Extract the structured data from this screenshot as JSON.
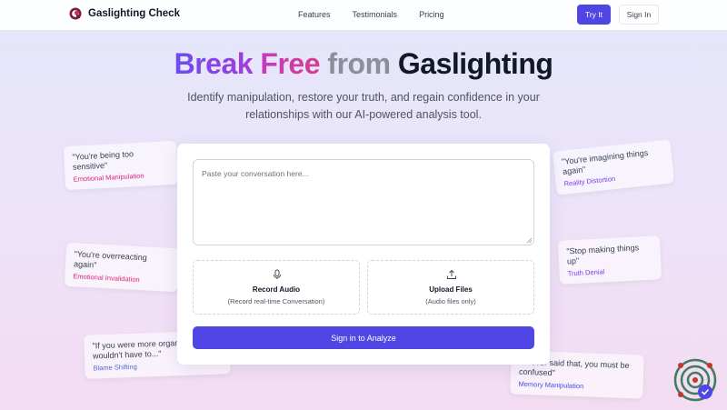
{
  "nav": {
    "brand": "Gaslighting Check",
    "links": [
      "Features",
      "Testimonials",
      "Pricing"
    ],
    "try_label": "Try It",
    "signin_label": "Sign In"
  },
  "hero": {
    "headline_parts": [
      "Break",
      "Free",
      "from",
      "Gaslighting"
    ],
    "subtitle": "Identify manipulation, restore your truth, and regain confidence in your relationships with our AI-powered analysis tool."
  },
  "quotes": [
    {
      "text": "\"You're being too sensitive\"",
      "tag": "Emotional Manipulation",
      "tag_color": "#db2777"
    },
    {
      "text": "\"You're overreacting again\"",
      "tag": "Emotional Invalidation",
      "tag_color": "#db2777"
    },
    {
      "text": "\"If you were more organized, I wouldn't have to...\"",
      "tag": "Blame Shifting",
      "tag_color": "#4f6bd8"
    },
    {
      "text": "\"You're imagining things again\"",
      "tag": "Reality Distortion",
      "tag_color": "#7c3aed"
    },
    {
      "text": "\"Stop making things up\"",
      "tag": "Truth Denial",
      "tag_color": "#7c3aed"
    },
    {
      "text": "\"I never said that, you must be confused\"",
      "tag": "Memory Manipulation",
      "tag_color": "#4f46e5"
    }
  ],
  "analyzer": {
    "placeholder": "Paste your conversation here...",
    "record_title": "Record Audio",
    "record_sub": "(Record real-time Conversation)",
    "upload_title": "Upload Files",
    "upload_sub": "(Audio files only)",
    "submit_label": "Sign in to Analyze"
  },
  "colors": {
    "accent": "#4f46e5"
  },
  "icons": {
    "brand": "gaslighting-check-logo",
    "record": "microphone-icon",
    "upload": "upload-icon",
    "widget": "chat-widget-icon"
  }
}
